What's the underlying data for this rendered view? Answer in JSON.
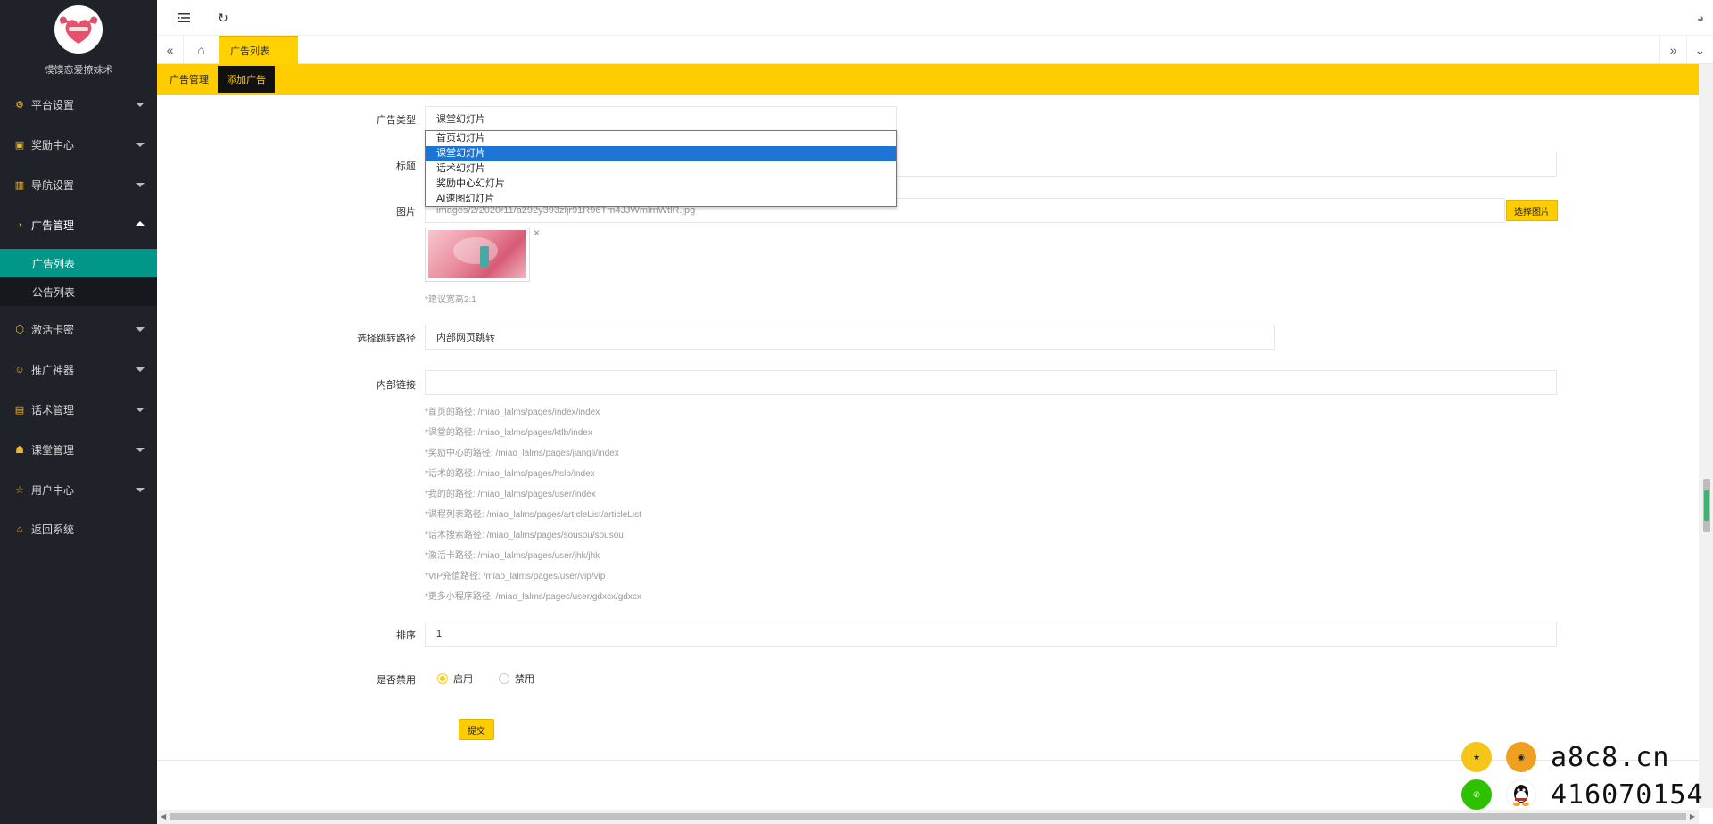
{
  "sidebar": {
    "brand": "馍馍恋爱撩妹术",
    "menu": [
      {
        "label": "平台设置"
      },
      {
        "label": "奖励中心"
      },
      {
        "label": "导航设置"
      },
      {
        "label": "广告管理"
      },
      {
        "label": "激活卡密"
      },
      {
        "label": "推广神器"
      },
      {
        "label": "话术管理"
      },
      {
        "label": "课堂管理"
      },
      {
        "label": "用户中心"
      },
      {
        "label": "返回系统"
      }
    ],
    "submenu": [
      {
        "label": "广告列表"
      },
      {
        "label": "公告列表"
      }
    ]
  },
  "tabs": {
    "active": "广告列表"
  },
  "subnav": {
    "items": [
      {
        "label": "广告管理"
      },
      {
        "label": "添加广告"
      }
    ]
  },
  "form": {
    "ad_type_label": "广告类型",
    "ad_type_value": "课堂幻灯片",
    "ad_type_options": [
      "首页幻灯片",
      "课堂幻灯片",
      "话术幻灯片",
      "奖励中心幻灯片",
      "AI速图幻灯片"
    ],
    "title_label": "标题",
    "title_value": "",
    "image_label": "图片",
    "image_value": "images/2/2020/11/a292y393zljr91R96Tm4JJWmlmWtlR.jpg",
    "choose_image": "选择图片",
    "image_hint": "*建议宽高2:1",
    "route_label": "选择跳转路径",
    "route_value": "内部网页跳转",
    "link_label": "内部链接",
    "link_value": "",
    "paths": [
      "*首页的路径:   /miao_lalms/pages/index/index",
      "*课堂的路径:   /miao_lalms/pages/ktlb/index",
      "*奖励中心的路径:   /miao_lalms/pages/jiangli/index",
      "*话术的路径:   /miao_lalms/pages/hslb/index",
      "*我的的路径:   /miao_lalms/pages/user/index",
      "*课程列表路径:   /miao_lalms/pages/articleList/articleList",
      "*话术搜索路径:   /miao_lalms/pages/sousou/sousou",
      "*激活卡路径:   /miao_lalms/pages/user/jhk/jhk",
      "*VIP充值路径:   /miao_lalms/pages/user/vip/vip",
      "*更多小程序路径:   /miao_lalms/pages/user/gdxcx/gdxcx"
    ],
    "sort_label": "排序",
    "sort_value": "1",
    "disable_label": "是否禁用",
    "enable_option": "启用",
    "disable_option": "禁用",
    "submit": "提交"
  },
  "watermark": {
    "site": "a8c8.cn",
    "qq": "416070154"
  },
  "colors": {
    "accent": "#ffcc00",
    "sidebar_bg": "#20222a",
    "active_teal": "#009688",
    "select_blue": "#1e74d5"
  }
}
